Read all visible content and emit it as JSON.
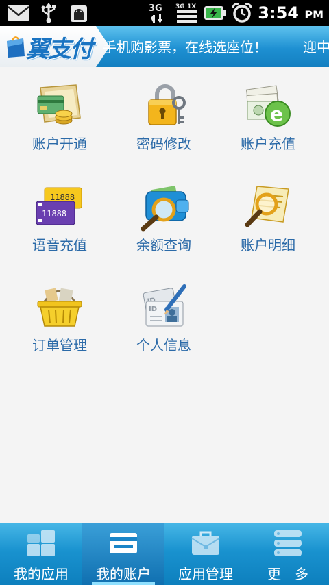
{
  "status_bar": {
    "icons_left": [
      "mail-icon",
      "usb-icon",
      "android-debug-icon"
    ],
    "icons_right": [
      "3g-data-icon",
      "signal-3g-1x-icon",
      "battery-charging-icon",
      "alarm-icon"
    ],
    "time": "3:54",
    "ampm": "PM",
    "net_3g": "3G",
    "net_3g_small": "3G",
    "net_1x": "1X"
  },
  "header": {
    "logo_text": "翼支付",
    "marquee_text": "手机购影票，在线选座位！",
    "marquee_text_next": "迎中"
  },
  "grid": {
    "items": [
      {
        "label": "账户开通",
        "icon": "account-open-icon"
      },
      {
        "label": "密码修改",
        "icon": "password-lock-icon"
      },
      {
        "label": "账户充值",
        "icon": "account-recharge-icon"
      },
      {
        "label": "语音充值",
        "icon": "voice-recharge-icon"
      },
      {
        "label": "余额查询",
        "icon": "balance-query-icon"
      },
      {
        "label": "账户明细",
        "icon": "account-detail-icon"
      },
      {
        "label": "订单管理",
        "icon": "order-basket-icon"
      },
      {
        "label": "个人信息",
        "icon": "personal-info-icon"
      }
    ],
    "voice_numbers": [
      "11888",
      "11888"
    ]
  },
  "tabs": [
    {
      "label": "我的应用",
      "icon": "my-apps-icon",
      "active": false
    },
    {
      "label": "我的账户",
      "icon": "my-account-icon",
      "active": true
    },
    {
      "label": "应用管理",
      "icon": "app-manage-icon",
      "active": false
    },
    {
      "label": "更　多",
      "icon": "more-icon",
      "active": false
    }
  ],
  "colors": {
    "header_blue": "#1e90d2",
    "label_blue": "#2b6aa8",
    "tab_blue": "#1992cf"
  }
}
